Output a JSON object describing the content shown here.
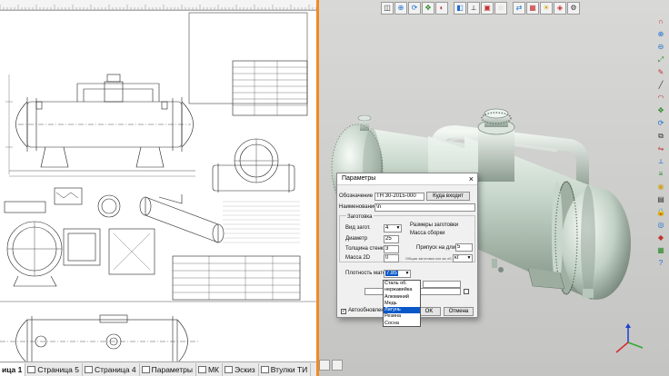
{
  "sheet_tabs": [
    {
      "label": "ица 1",
      "active": true
    },
    {
      "label": "Страница 5",
      "active": false
    },
    {
      "label": "Страница 4",
      "active": false
    },
    {
      "label": "Параметры",
      "active": false
    },
    {
      "label": "МК",
      "active": false
    },
    {
      "label": "Эскиз",
      "active": false
    },
    {
      "label": "Втулки ТИ",
      "active": false
    }
  ],
  "view_toolbar_icons": [
    "view-select-icon",
    "zoom-icon",
    "rotate-icon",
    "pan-icon",
    "shading-icon",
    "section-icon",
    "measure-icon",
    "box-icon",
    "hide-icon",
    "orient-icon",
    "cube-icon",
    "light-icon",
    "render-icon",
    "settings-icon"
  ],
  "right_toolbar_icons": [
    "magnet-icon",
    "zoom-in-icon",
    "zoom-out-icon",
    "fit-icon",
    "pen-icon",
    "line-icon",
    "arc-icon",
    "move-icon",
    "rotate-icon",
    "copy-icon",
    "mirror-icon",
    "measure-icon",
    "layer-icon",
    "color-icon",
    "properties-icon",
    "lock-icon",
    "eye-icon",
    "material-icon",
    "grid-icon",
    "help-icon"
  ],
  "dialog": {
    "title": "Параметры",
    "close": "×",
    "designation_label": "Обозначение",
    "designation_value": "ТН 30-2015-000",
    "part_of_label": "Куда входит",
    "name_label": "Наименование",
    "name_value": "\\n",
    "blank_group": "Заготовка",
    "blank_type_label": "Вид загот.",
    "blank_type_value": "4",
    "blank_params_label": "Размеры заготовки",
    "assembly_mass_label": "Масса сборки",
    "diameter_label": "Диаметр",
    "diameter_value": "25",
    "wall_label": "Толщина стенки",
    "wall_value": "3",
    "allowance_label": "Припуск на длину",
    "allowance_value": "5",
    "mass_label": "Масса 2D",
    "mass_value": "0",
    "total_length_label": "Общая заготовки кол-во об.",
    "unit_value": "кг",
    "density_label": "Плотность матер.",
    "density_value": "7.85",
    "auto_update_label": "Автообновление",
    "ok_label": "OK",
    "cancel_label": "Отмена"
  },
  "dropdown": {
    "options": [
      "Сталь об.",
      "нержавейка",
      "Алюминий",
      "Медь",
      "Латунь",
      "Резина",
      "Сосна"
    ],
    "selected_index": 4
  },
  "colors": {
    "splitter": "#f08a24",
    "selection": "#0a58c8",
    "model": "#c3d3c6"
  }
}
